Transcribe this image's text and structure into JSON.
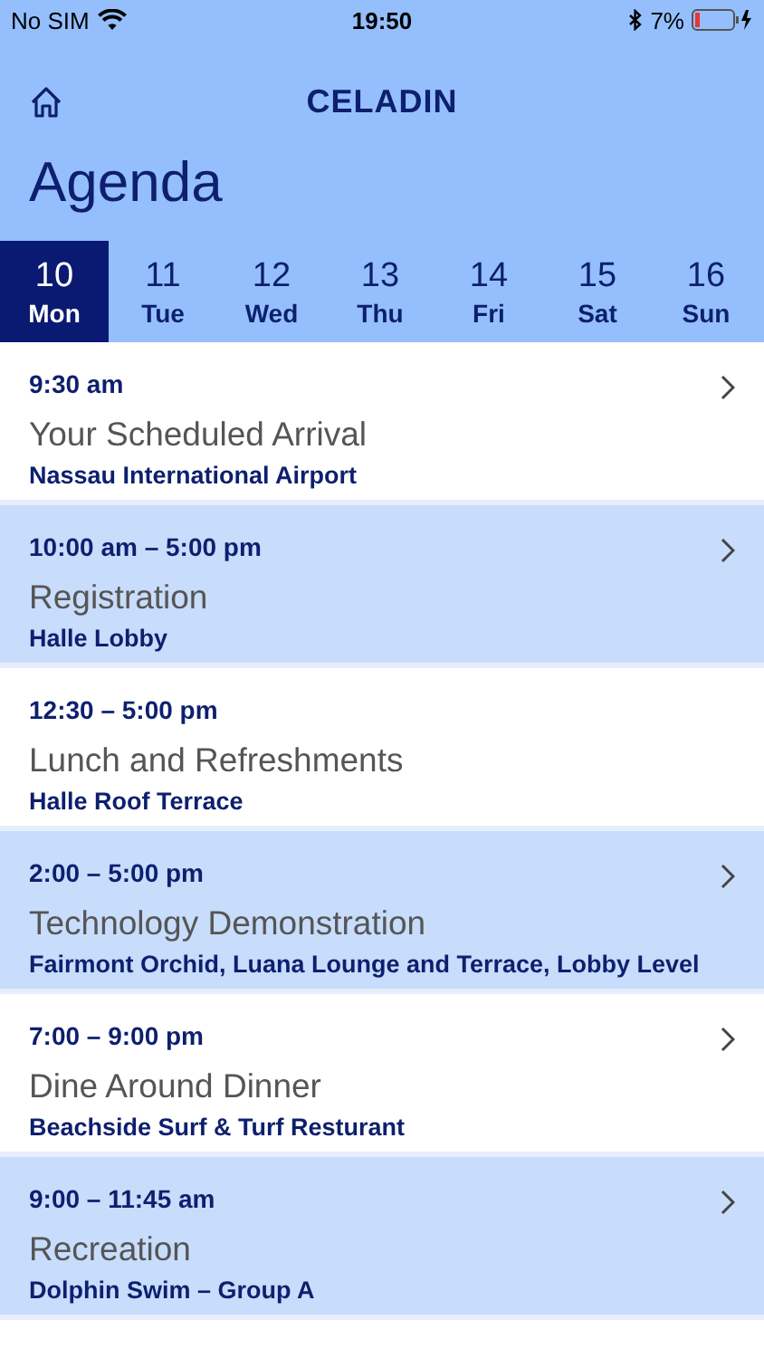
{
  "status_bar": {
    "carrier": "No SIM",
    "time": "19:50",
    "battery": "7%"
  },
  "header": {
    "brand": "CELADIN",
    "title": "Agenda"
  },
  "days": [
    {
      "number": "10",
      "weekday": "Mon",
      "selected": true
    },
    {
      "number": "11",
      "weekday": "Tue",
      "selected": false
    },
    {
      "number": "12",
      "weekday": "Wed",
      "selected": false
    },
    {
      "number": "13",
      "weekday": "Thu",
      "selected": false
    },
    {
      "number": "14",
      "weekday": "Fri",
      "selected": false
    },
    {
      "number": "15",
      "weekday": "Sat",
      "selected": false
    },
    {
      "number": "16",
      "weekday": "Sun",
      "selected": false
    }
  ],
  "events": [
    {
      "time": "9:30 am",
      "title": "Your Scheduled Arrival",
      "location": "Nassau International Airport",
      "shaded": false,
      "has_detail": true
    },
    {
      "time": "10:00 am – 5:00 pm",
      "title": "Registration",
      "location": "Halle Lobby",
      "shaded": true,
      "has_detail": true
    },
    {
      "time": "12:30 – 5:00 pm",
      "title": "Lunch and Refreshments",
      "location": "Halle Roof Terrace",
      "shaded": false,
      "has_detail": false
    },
    {
      "time": "2:00 – 5:00 pm",
      "title": "Technology Demonstration",
      "location": "Fairmont Orchid, Luana Lounge and Terrace, Lobby Level",
      "shaded": true,
      "has_detail": true
    },
    {
      "time": "7:00 – 9:00 pm",
      "title": "Dine Around Dinner",
      "location": "Beachside Surf & Turf Resturant",
      "shaded": false,
      "has_detail": true
    },
    {
      "time": "9:00 – 11:45 am",
      "title": "Recreation",
      "location": "Dolphin Swim – Group A",
      "shaded": true,
      "has_detail": true
    }
  ]
}
